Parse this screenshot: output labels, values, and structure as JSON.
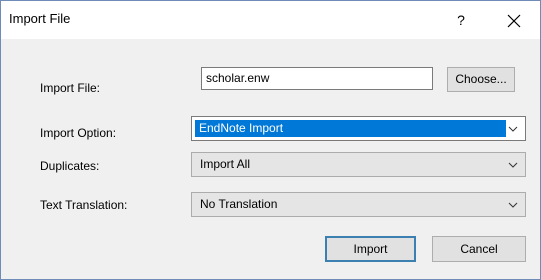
{
  "window": {
    "title": "Import File",
    "help_label": "?",
    "close_label": "✕"
  },
  "form": {
    "import_file_label": "Import File:",
    "import_file_value": "scholar.enw",
    "choose_label": "Choose...",
    "import_option_label": "Import Option:",
    "import_option_value": "EndNote Import",
    "duplicates_label": "Duplicates:",
    "duplicates_value": "Import All",
    "text_translation_label": "Text Translation:",
    "text_translation_value": "No Translation"
  },
  "buttons": {
    "import_label": "Import",
    "cancel_label": "Cancel"
  },
  "colors": {
    "selection": "#0078d7",
    "default_button_border": "#3c7fb1"
  },
  "icons": [
    "help-icon",
    "close-icon",
    "chevron-down-icon"
  ]
}
